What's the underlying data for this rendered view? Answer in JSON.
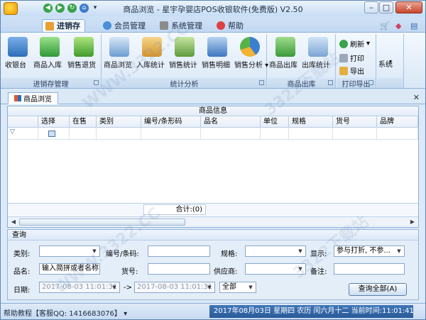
{
  "window": {
    "title": "商品浏览 - 星宇孕婴店POS收银软件(免费版) V2.50"
  },
  "tabs": [
    {
      "label": "进销存",
      "active": true
    },
    {
      "label": "会员管理"
    },
    {
      "label": "系统管理"
    },
    {
      "label": "帮助"
    }
  ],
  "ribbon": {
    "groups": [
      {
        "title": "进销存管理",
        "buttons": [
          "收银台",
          "商品入库",
          "销售退货"
        ]
      },
      {
        "title": "统计分析",
        "buttons": [
          "商品浏览",
          "入库统计",
          "销售统计",
          "销售明细",
          "销售分析"
        ]
      },
      {
        "title": "商品出库",
        "buttons": [
          "商品出库",
          "出库统计"
        ]
      },
      {
        "title": "打印导出",
        "buttons": [
          "刷新",
          "打印",
          "导出"
        ]
      },
      {
        "title": "",
        "buttons": [
          "系统"
        ]
      }
    ]
  },
  "doc_tab": {
    "label": "商品浏览"
  },
  "grid": {
    "group_header": "商品信息",
    "columns": [
      "选择",
      "在售",
      "类别",
      "编号/条形码",
      "品名",
      "单位",
      "规格",
      "货号",
      "品牌"
    ],
    "footer_total": "合计:(0)"
  },
  "query": {
    "title": "查询",
    "labels": {
      "category": "类别:",
      "code": "编号/条码:",
      "spec": "规格:",
      "display": "显示:",
      "name": "品名:",
      "item_no": "货号:",
      "supplier": "供应商:",
      "note": "备注:",
      "date": "日期:",
      "arrow": "->"
    },
    "name_placeholder": "输入简拼或者名称",
    "display_value": "参与打折, 不参...",
    "date_from": "2017-08-03 11:01:31",
    "date_to": "2017-08-03 11:01:31",
    "range_value": "全部",
    "button": "查询全部(A)"
  },
  "status": {
    "help": "帮助教程【客服QQ: 1416683076】",
    "datetime": "2017年08月03日 星期四 农历 闰六月十二 当前时间:11:01:41"
  },
  "watermarks": [
    "WWW.3322.CC",
    "3322下载站"
  ]
}
